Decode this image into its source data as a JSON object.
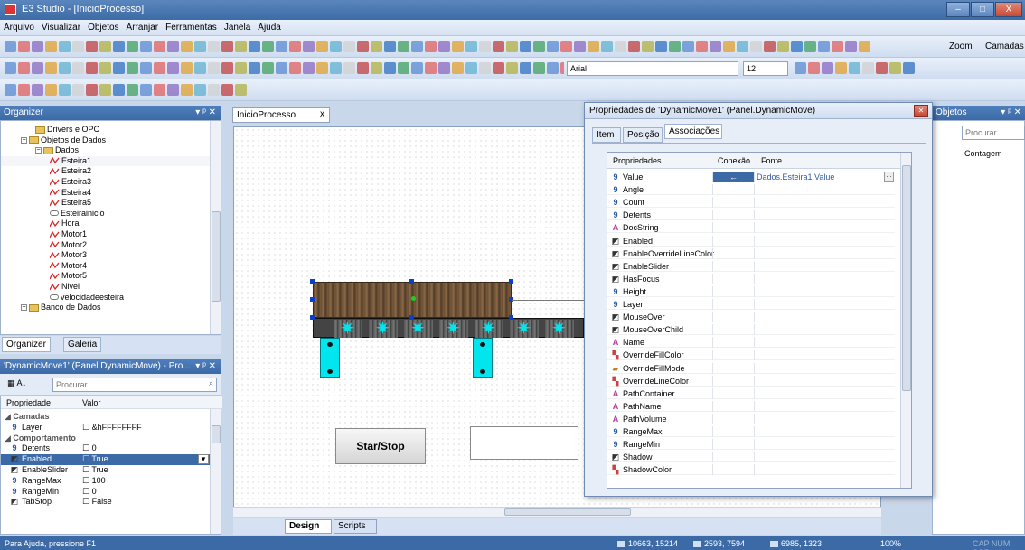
{
  "window": {
    "title": "E3 Studio - [InicioProcesso]",
    "btn_min": "–",
    "btn_max": "□",
    "btn_close": "X"
  },
  "menu": [
    "Arquivo",
    "Visualizar",
    "Objetos",
    "Arranjar",
    "Ferramentas",
    "Janela",
    "Ajuda"
  ],
  "toolbar": {
    "zoom_label": "Zoom",
    "camadas_label": "Camadas",
    "font_name": "Arial",
    "font_size": "12"
  },
  "organizer": {
    "title": "Organizer",
    "tree": [
      {
        "label": "Drivers e OPC",
        "icon": "folder-icon",
        "indent": 2
      },
      {
        "label": "Objetos de Dados",
        "icon": "folder-icon",
        "indent": 1,
        "expander": "−"
      },
      {
        "label": "Dados",
        "icon": "folder-icon",
        "indent": 2,
        "expander": "−"
      },
      {
        "label": "Esteira1",
        "icon": "tag-wave-icon",
        "indent": 3,
        "selected": true
      },
      {
        "label": "Esteira2",
        "icon": "tag-wave-icon",
        "indent": 3
      },
      {
        "label": "Esteira3",
        "icon": "tag-wave-icon",
        "indent": 3
      },
      {
        "label": "Esteira4",
        "icon": "tag-wave-icon",
        "indent": 3
      },
      {
        "label": "Esteira5",
        "icon": "tag-wave-icon",
        "indent": 3
      },
      {
        "label": "Esteirainicio",
        "icon": "field-icon",
        "indent": 3
      },
      {
        "label": "Hora",
        "icon": "tag-wave-icon",
        "indent": 3
      },
      {
        "label": "Motor1",
        "icon": "tag-wave-icon",
        "indent": 3
      },
      {
        "label": "Motor2",
        "icon": "tag-wave-icon",
        "indent": 3
      },
      {
        "label": "Motor3",
        "icon": "tag-wave-icon",
        "indent": 3
      },
      {
        "label": "Motor4",
        "icon": "tag-wave-icon",
        "indent": 3
      },
      {
        "label": "Motor5",
        "icon": "tag-wave-icon",
        "indent": 3
      },
      {
        "label": "Nivel",
        "icon": "tag-wave-icon",
        "indent": 3
      },
      {
        "label": "velocidadeesteira",
        "icon": "field-icon",
        "indent": 3
      },
      {
        "label": "Banco de Dados",
        "icon": "folder-icon",
        "indent": 1,
        "expander": "+"
      }
    ],
    "tab_organizer": "Organizer",
    "tab_galeria": "Galeria"
  },
  "propsPanel": {
    "title": "'DynamicMove1' (Panel.DynamicMove) - Pro...",
    "search_placeholder": "Procurar",
    "col_prop": "Propriedade",
    "col_val": "Valor",
    "rows": [
      {
        "type": "cat",
        "name": "Camadas"
      },
      {
        "type": "prop",
        "icon": "9",
        "name": "Layer",
        "value": "&hFFFFFFFF"
      },
      {
        "type": "cat",
        "name": "Comportamento"
      },
      {
        "type": "prop",
        "icon": "9",
        "name": "Detents",
        "value": "0"
      },
      {
        "type": "prop",
        "icon": "B",
        "name": "Enabled",
        "value": "True",
        "selected": true
      },
      {
        "type": "prop",
        "icon": "B",
        "name": "EnableSlider",
        "value": "True"
      },
      {
        "type": "prop",
        "icon": "9",
        "name": "RangeMax",
        "value": "100"
      },
      {
        "type": "prop",
        "icon": "9",
        "name": "RangeMin",
        "value": "0"
      },
      {
        "type": "prop",
        "icon": "B",
        "name": "TabStop",
        "value": "False"
      }
    ]
  },
  "doc": {
    "tab_title": "InicioProcesso",
    "close": "x",
    "button_label": "Star/Stop",
    "tab_design": "Design",
    "tab_scripts": "Scripts"
  },
  "dialog": {
    "title": "Propriedades de 'DynamicMove1' (Panel.DynamicMove)",
    "tabs": [
      "Item",
      "Posição",
      "Associações"
    ],
    "col_prop": "Propriedades",
    "col_conexao": "Conexão",
    "col_fonte": "Fonte",
    "rows": [
      {
        "t": "9",
        "n": "Value",
        "c": "←",
        "f": "Dados.Esteira1.Value",
        "btn": "..."
      },
      {
        "t": "9",
        "n": "Angle"
      },
      {
        "t": "9",
        "n": "Count"
      },
      {
        "t": "9",
        "n": "Detents"
      },
      {
        "t": "A",
        "n": "DocString"
      },
      {
        "t": "B",
        "n": "Enabled"
      },
      {
        "t": "B",
        "n": "EnableOverrideLineColor"
      },
      {
        "t": "B",
        "n": "EnableSlider"
      },
      {
        "t": "B",
        "n": "HasFocus"
      },
      {
        "t": "9",
        "n": "Height"
      },
      {
        "t": "9",
        "n": "Layer"
      },
      {
        "t": "B",
        "n": "MouseOver"
      },
      {
        "t": "B",
        "n": "MouseOverChild"
      },
      {
        "t": "A",
        "n": "Name"
      },
      {
        "t": "C",
        "n": "OverrideFillColor"
      },
      {
        "t": "M",
        "n": "OverrideFillMode"
      },
      {
        "t": "C",
        "n": "OverrideLineColor"
      },
      {
        "t": "A",
        "n": "PathContainer"
      },
      {
        "t": "A",
        "n": "PathName"
      },
      {
        "t": "A",
        "n": "PathVolume"
      },
      {
        "t": "9",
        "n": "RangeMax"
      },
      {
        "t": "9",
        "n": "RangeMin"
      },
      {
        "t": "B",
        "n": "Shadow"
      },
      {
        "t": "C",
        "n": "ShadowColor"
      }
    ]
  },
  "objetos": {
    "title": "Objetos",
    "search_placeholder": "Procurar",
    "col": "Contagem"
  },
  "status": {
    "help": "Para Ajuda, pressione F1",
    "coord1": "10663, 15214",
    "coord2": "2593, 7594",
    "coord3": "6985, 1323",
    "zoom": "100%",
    "keys": "CAP NUM SCR"
  },
  "colors": {
    "title_bar": "#3d6ba5",
    "type_int": "#2c5aa0",
    "type_str": "#b03aa0",
    "cyan": "#00e5ee",
    "wood": "#7a5a3a"
  }
}
